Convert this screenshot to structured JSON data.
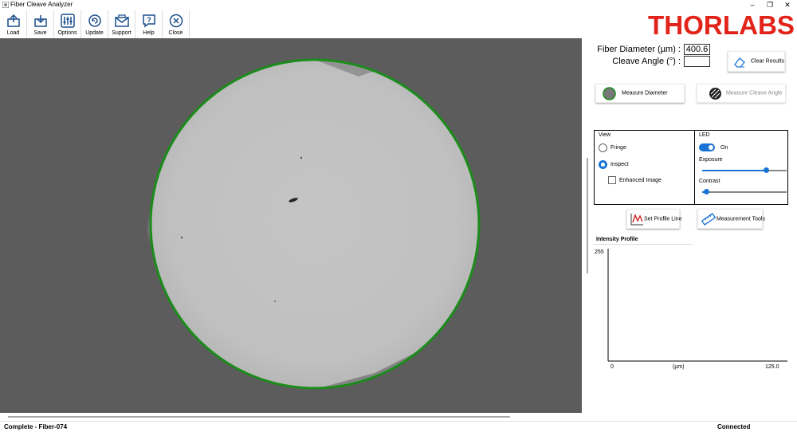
{
  "window": {
    "title": "Fiber Cleave Analyzer"
  },
  "toolbar": {
    "items": [
      {
        "label": "Load",
        "icon": "load-icon"
      },
      {
        "label": "Save",
        "icon": "save-icon"
      },
      {
        "label": "Options",
        "icon": "options-icon"
      },
      {
        "label": "Update",
        "icon": "update-icon"
      },
      {
        "label": "Support",
        "icon": "support-icon"
      },
      {
        "label": "Help",
        "icon": "help-icon"
      },
      {
        "label": "Close",
        "icon": "close-icon"
      }
    ]
  },
  "brand": {
    "logo_text": "THORLABS",
    "color": "#e2231a"
  },
  "results": {
    "diameter_label": "Fiber Diameter (µm) :",
    "diameter_value": "400.6",
    "angle_label": "Cleave Angle (°) :",
    "angle_value": "",
    "clear_button": "Clear Results"
  },
  "actions": {
    "measure_diameter": "Measure Diameter",
    "measure_cleave_angle": "Measure Cleave Angle"
  },
  "view_panel": {
    "title": "View",
    "options": [
      "Fringe",
      "Inspect"
    ],
    "selected": "Inspect",
    "enhanced_label": "Enhanced Image",
    "enhanced_checked": false
  },
  "led_panel": {
    "title": "LED",
    "state_label": "On",
    "state_on": true,
    "exposure_label": "Exposure",
    "exposure_level": 0.75,
    "contrast_label": "Contrast",
    "contrast_level": 0.05
  },
  "tools": {
    "set_profile_line": "Set Profile Line",
    "measurement_tools": "Measurement Tools"
  },
  "profile": {
    "tab_label": "Intensity Profile",
    "y_max": "255",
    "x_min": "0",
    "x_unit": "(µm)",
    "x_max": "125.0"
  },
  "status": {
    "left": "Complete - Fiber-074",
    "right": "Connected"
  },
  "colors": {
    "accent": "#1a73d6",
    "circle": "#1a8c1a",
    "viewer_bg": "#5c5c5c"
  }
}
